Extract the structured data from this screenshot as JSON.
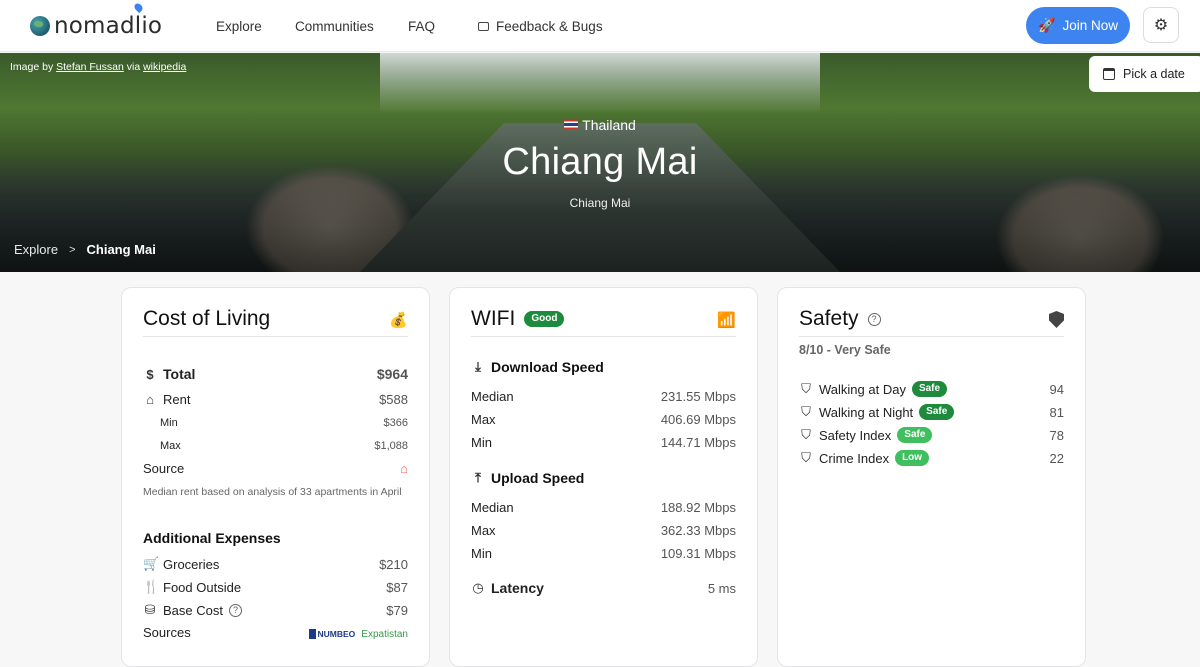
{
  "nav": {
    "logo_text": "nomadlio",
    "links": {
      "explore": "Explore",
      "communities": "Communities",
      "faq": "FAQ",
      "feedback": "Feedback & Bugs"
    },
    "join_label": "Join Now"
  },
  "hero": {
    "credit_prefix": "Image by ",
    "credit_author": "Stefan Fussan",
    "credit_mid": " via ",
    "credit_source": "wikipedia",
    "pick_date": "Pick a date",
    "country": "Thailand",
    "city": "Chiang Mai",
    "subtitle": "Chiang Mai",
    "breadcrumb": {
      "root": "Explore",
      "current": "Chiang Mai"
    }
  },
  "cost": {
    "title": "Cost of Living",
    "total_label": "Total",
    "total_value": "$964",
    "rent_label": "Rent",
    "rent_value": "$588",
    "min_label": "Min",
    "min_value": "$366",
    "max_label": "Max",
    "max_value": "$1,088",
    "source_label": "Source",
    "note": "Median rent based on analysis of 33 apartments in April",
    "additional_title": "Additional Expenses",
    "groceries_label": "Groceries",
    "groceries_value": "$210",
    "food_label": "Food Outside",
    "food_value": "$87",
    "base_label": "Base Cost",
    "base_value": "$79",
    "sources_label": "Sources",
    "numbeo": "NUMBEO",
    "expatistan": "Expatistan"
  },
  "wifi": {
    "title": "WIFI",
    "badge": "Good",
    "download_title": "Download Speed",
    "download": {
      "median_label": "Median",
      "median": "231.55 Mbps",
      "max_label": "Max",
      "max": "406.69 Mbps",
      "min_label": "Min",
      "min": "144.71 Mbps"
    },
    "upload_title": "Upload Speed",
    "upload": {
      "median_label": "Median",
      "median": "188.92 Mbps",
      "max_label": "Max",
      "max": "362.33 Mbps",
      "min_label": "Min",
      "min": "109.31 Mbps"
    },
    "latency_title": "Latency",
    "latency": "5 ms"
  },
  "safety": {
    "title": "Safety",
    "score": "8/10 - Very Safe",
    "items": [
      {
        "label": "Walking at Day",
        "badge": "Safe",
        "value": "94"
      },
      {
        "label": "Walking at Night",
        "badge": "Safe",
        "value": "81"
      },
      {
        "label": "Safety Index",
        "badge": "Safe",
        "value": "78"
      },
      {
        "label": "Crime Index",
        "badge": "Low",
        "value": "22"
      }
    ]
  }
}
